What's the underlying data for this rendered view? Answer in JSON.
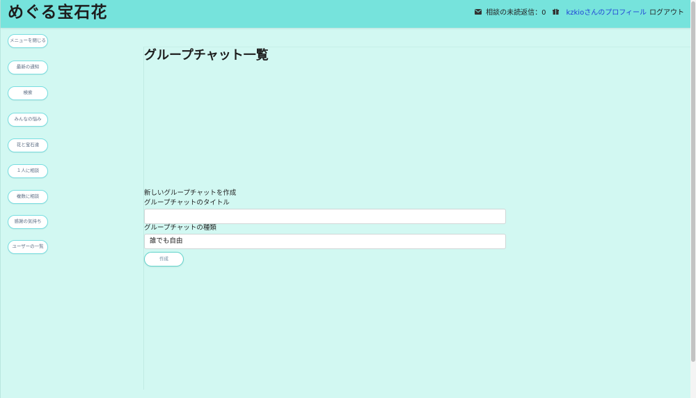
{
  "header": {
    "brand": "めぐる宝石花",
    "unread_label": "相談の未読返信：0",
    "profile_link": "kzkioさんのプロフィール",
    "logout": "ログアウト"
  },
  "sidebar": {
    "items": [
      {
        "label": "メニューを閉じる"
      },
      {
        "label": "最新の通知"
      },
      {
        "label": "検索"
      },
      {
        "label": "みんなの悩み"
      },
      {
        "label": "花と宝石達"
      },
      {
        "label": "１人に相談"
      },
      {
        "label": "複数に相談"
      },
      {
        "label": "感謝の気持ち"
      },
      {
        "label": "ユーザーの一覧"
      }
    ]
  },
  "main": {
    "title": "グループチャット一覧",
    "create_heading": "新しいグループチャットを作成",
    "title_field_label": "グループチャットのタイトル",
    "title_field_value": "",
    "type_field_label": "グループチャットの種類",
    "type_field_value": "誰でも自由",
    "create_button": "作成"
  },
  "icons": {
    "mail": "envelope-icon",
    "gift": "gift-icon"
  },
  "colors": {
    "header_bg": "#76e3dc",
    "page_bg": "#d2f8f2",
    "button_border": "#77dde0",
    "link": "#1e3fd6"
  }
}
